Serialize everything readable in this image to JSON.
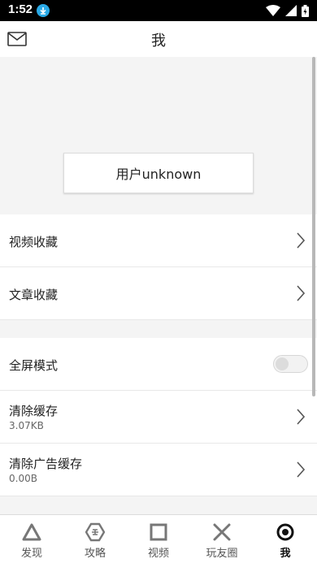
{
  "status_bar": {
    "time": "1:52"
  },
  "header": {
    "title": "我"
  },
  "profile": {
    "username": "用户unknown"
  },
  "rows": {
    "video_favorites": "视频收藏",
    "article_favorites": "文章收藏",
    "fullscreen_mode": "全屏模式",
    "fullscreen_enabled": false,
    "clear_cache": "清除缓存",
    "clear_cache_size": "3.07KB",
    "clear_ad_cache": "清除广告缓存",
    "clear_ad_cache_size": "0.00B"
  },
  "nav": {
    "discover": "发现",
    "guides": "攻略",
    "videos": "视频",
    "friends": "玩友圈",
    "me": "我"
  },
  "icons": {
    "mail": "mail-icon",
    "chevron": "chevron-right-icon",
    "discover": "triangle-icon",
    "guides": "hexagon-icon",
    "videos": "square-icon",
    "friends": "cross-icon",
    "me": "circle-icon"
  },
  "colors": {
    "download_badge": "#29a9e6",
    "background_gray": "#f4f4f4"
  }
}
